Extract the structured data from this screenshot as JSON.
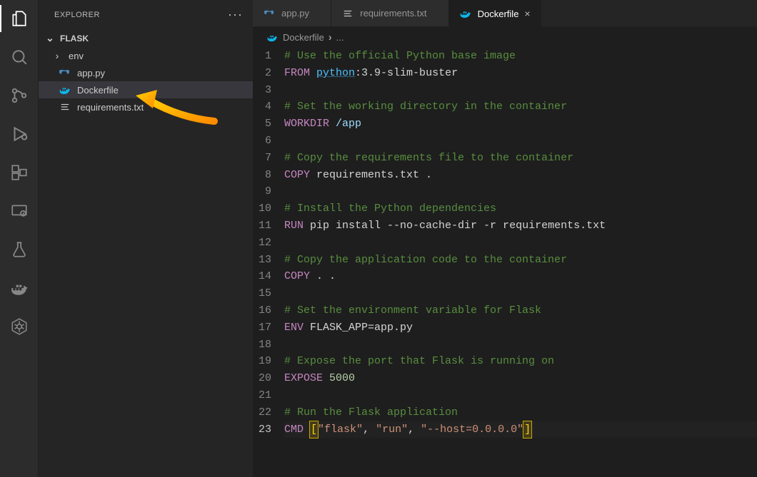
{
  "sidebar": {
    "title": "EXPLORER",
    "folder": "FLASK",
    "items": [
      {
        "name": "env",
        "kind": "folder",
        "collapsed": true
      },
      {
        "name": "app.py",
        "kind": "file",
        "icon": "python"
      },
      {
        "name": "Dockerfile",
        "kind": "file",
        "icon": "docker",
        "selected": true
      },
      {
        "name": "requirements.txt",
        "kind": "file",
        "icon": "lines"
      }
    ]
  },
  "tabs": [
    {
      "name": "app.py",
      "icon": "python",
      "active": false
    },
    {
      "name": "requirements.txt",
      "icon": "lines",
      "active": false
    },
    {
      "name": "Dockerfile",
      "icon": "docker",
      "active": true
    }
  ],
  "breadcrumb": {
    "file": "Dockerfile",
    "rest": "..."
  },
  "code": {
    "current_line": 23,
    "lines": [
      [
        {
          "t": "comment",
          "s": "# Use the official Python base image"
        }
      ],
      [
        {
          "t": "keyword",
          "s": "FROM"
        },
        {
          "t": "plain",
          "s": " "
        },
        {
          "t": "link",
          "s": "python"
        },
        {
          "t": "plain",
          "s": ":3.9-slim-buster"
        }
      ],
      [],
      [
        {
          "t": "comment",
          "s": "# Set the working directory in the container"
        }
      ],
      [
        {
          "t": "keyword",
          "s": "WORKDIR"
        },
        {
          "t": "plain",
          "s": " "
        },
        {
          "t": "var",
          "s": "/app"
        }
      ],
      [],
      [
        {
          "t": "comment",
          "s": "# Copy the requirements file to the container"
        }
      ],
      [
        {
          "t": "keyword",
          "s": "COPY"
        },
        {
          "t": "plain",
          "s": " requirements.txt ."
        }
      ],
      [],
      [
        {
          "t": "comment",
          "s": "# Install the Python dependencies"
        }
      ],
      [
        {
          "t": "keyword",
          "s": "RUN"
        },
        {
          "t": "plain",
          "s": " pip install --no-cache-dir -r requirements.txt"
        }
      ],
      [],
      [
        {
          "t": "comment",
          "s": "# Copy the application code to the container"
        }
      ],
      [
        {
          "t": "keyword",
          "s": "COPY"
        },
        {
          "t": "plain",
          "s": " . ."
        }
      ],
      [],
      [
        {
          "t": "comment",
          "s": "# Set the environment variable for Flask"
        }
      ],
      [
        {
          "t": "keyword",
          "s": "ENV"
        },
        {
          "t": "plain",
          "s": " FLASK_APP=app.py"
        }
      ],
      [],
      [
        {
          "t": "comment",
          "s": "# Expose the port that Flask is running on"
        }
      ],
      [
        {
          "t": "keyword",
          "s": "EXPOSE"
        },
        {
          "t": "plain",
          "s": " "
        },
        {
          "t": "num",
          "s": "5000"
        }
      ],
      [],
      [
        {
          "t": "comment",
          "s": "# Run the Flask application"
        }
      ],
      [
        {
          "t": "keyword",
          "s": "CMD"
        },
        {
          "t": "plain",
          "s": " "
        },
        {
          "t": "bracket",
          "s": "["
        },
        {
          "t": "str",
          "s": "\"flask\""
        },
        {
          "t": "plain",
          "s": ", "
        },
        {
          "t": "str",
          "s": "\"run\""
        },
        {
          "t": "plain",
          "s": ", "
        },
        {
          "t": "str",
          "s": "\"--host=0.0.0.0\""
        },
        {
          "t": "bracket",
          "s": "]"
        }
      ]
    ]
  },
  "activity_icons": [
    "files",
    "search",
    "git",
    "debug",
    "extensions",
    "remote",
    "test",
    "docker",
    "kubernetes"
  ]
}
